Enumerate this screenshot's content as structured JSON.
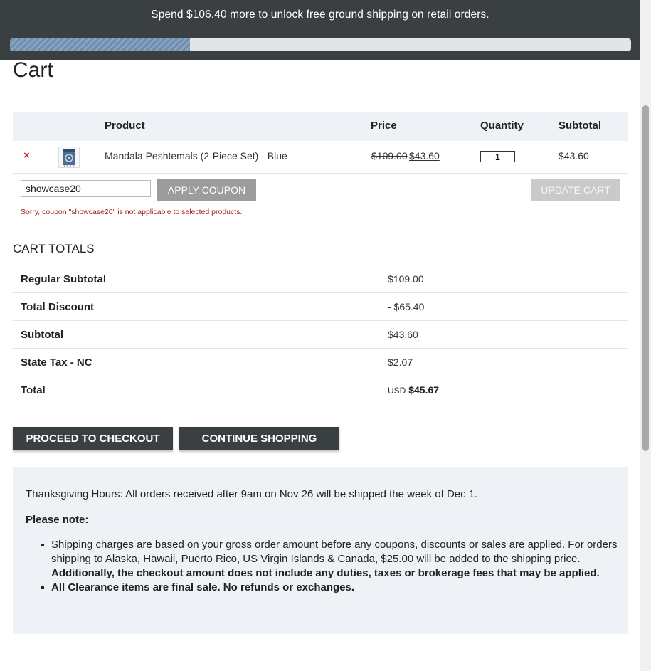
{
  "banner": {
    "message": "Spend $106.40 more to unlock free ground shipping on retail orders.",
    "progress_fraction": 0.29
  },
  "page": {
    "title": "Cart"
  },
  "cart_table": {
    "headers": [
      "Product",
      "Price",
      "Quantity",
      "Subtotal"
    ],
    "items": [
      {
        "remove": "×",
        "name": "Mandala Peshtemals (2-Piece Set) - Blue",
        "price_old": "$109.00",
        "price_new": "$43.60",
        "quantity": "1",
        "subtotal": "$43.60"
      }
    ]
  },
  "coupon": {
    "value": "showcase20",
    "apply_label": "APPLY COUPON",
    "update_label": "UPDATE CART",
    "error": "Sorry, coupon \"showcase20\" is not applicable to selected products."
  },
  "totals": {
    "title": "CART TOTALS",
    "rows": [
      {
        "label": "Regular Subtotal",
        "value": "$109.00"
      },
      {
        "label": "Total Discount",
        "value": "- $65.40"
      },
      {
        "label": "Subtotal",
        "value": "$43.60"
      },
      {
        "label": "State Tax - NC",
        "value": "$2.07"
      },
      {
        "label": "Total",
        "currency": "USD",
        "value": "$45.67"
      }
    ]
  },
  "actions": {
    "checkout_label": "PROCEED TO CHECKOUT",
    "continue_label": "CONTINUE SHOPPING"
  },
  "notice": {
    "hours": "Thanksgiving Hours: All orders received after 9am on Nov 26 will be shipped the week of Dec 1.",
    "title": "Please note:",
    "item1_text": "Shipping charges are based on your gross order amount before any coupons, discounts or sales are applied. For orders shipping to Alaska, Hawaii, Puerto Rico, US Virgin Islands & Canada, $25.00 will be added to the shipping price. ",
    "item1_bold": "Additionally, the checkout amount does not include any duties, taxes or brokerage fees that may be applied.",
    "item2": "All Clearance items are final sale. No refunds or exchanges."
  },
  "colors": {
    "banner_bg": "#3a3f42",
    "progress_fill": "#7594b4",
    "remove_icon": "#c0282b",
    "error_text": "#9e1b1b",
    "table_header_bg": "#eef2f6"
  }
}
